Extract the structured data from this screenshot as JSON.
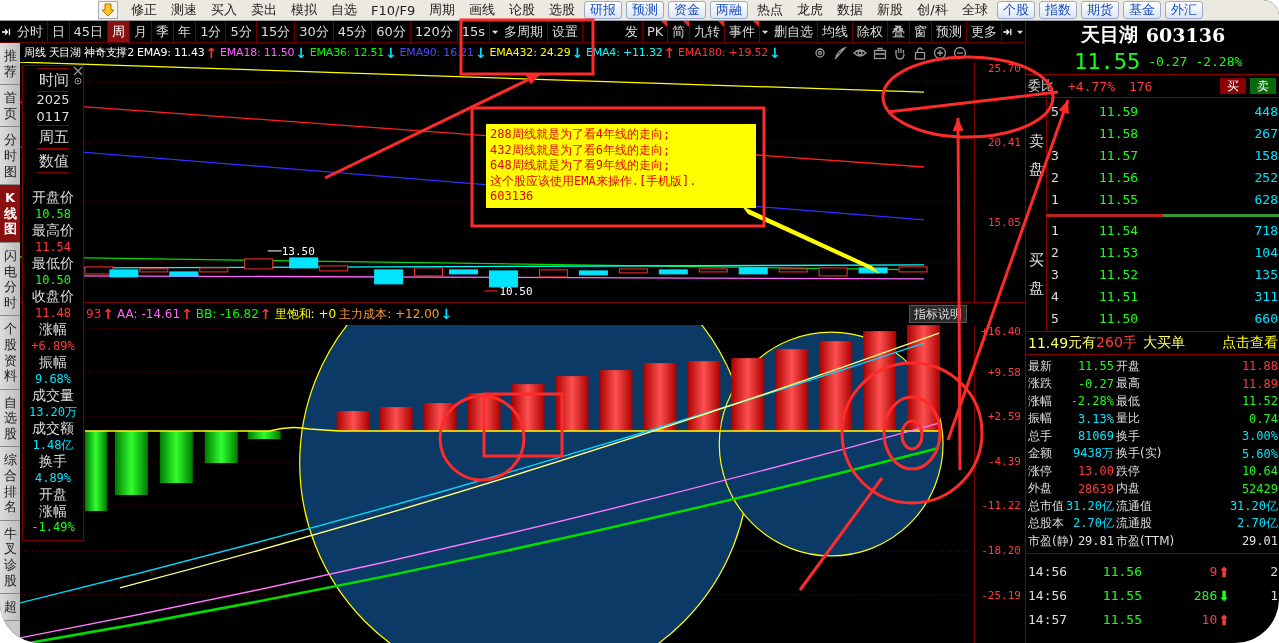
{
  "menu_bar": {
    "items": [
      {
        "label": "修正",
        "kind": "text"
      },
      {
        "label": "测速",
        "kind": "text"
      },
      {
        "label": "买入",
        "kind": "text"
      },
      {
        "label": "卖出",
        "kind": "text"
      },
      {
        "label": "模拟",
        "kind": "text"
      },
      {
        "label": "自选",
        "kind": "text"
      },
      {
        "label": "F10/F9",
        "kind": "text"
      },
      {
        "label": "周期",
        "kind": "text"
      },
      {
        "label": "画线",
        "kind": "text"
      },
      {
        "label": "论股",
        "kind": "text"
      },
      {
        "label": "选股",
        "kind": "text"
      },
      {
        "label": "研报",
        "kind": "button"
      },
      {
        "label": "预测",
        "kind": "button"
      },
      {
        "label": "资金",
        "kind": "button"
      },
      {
        "label": "两融",
        "kind": "button"
      },
      {
        "label": "热点",
        "kind": "text"
      },
      {
        "label": "龙虎",
        "kind": "text"
      },
      {
        "label": "数据",
        "kind": "text"
      },
      {
        "label": "新股",
        "kind": "text"
      },
      {
        "label": "创/科",
        "kind": "text"
      },
      {
        "label": "全球",
        "kind": "text"
      },
      {
        "label": "个股",
        "kind": "button"
      },
      {
        "label": "指数",
        "kind": "button"
      },
      {
        "label": "期货",
        "kind": "button"
      },
      {
        "label": "基金",
        "kind": "button"
      },
      {
        "label": "外汇",
        "kind": "button"
      }
    ]
  },
  "period_toolbar": {
    "tabs": [
      {
        "label": "分时",
        "selected": false
      },
      {
        "label": "日",
        "selected": false
      },
      {
        "label": "45日",
        "selected": false
      },
      {
        "label": "周",
        "selected": true
      },
      {
        "label": "月",
        "selected": false
      },
      {
        "label": "季",
        "selected": false
      },
      {
        "label": "年",
        "selected": false
      },
      {
        "label": "1分",
        "selected": false
      },
      {
        "label": "5分",
        "selected": false
      },
      {
        "label": "15分",
        "selected": false
      },
      {
        "label": "30分",
        "selected": false
      },
      {
        "label": "45分",
        "selected": false
      },
      {
        "label": "60分",
        "selected": false
      },
      {
        "label": "120分",
        "selected": false
      },
      {
        "label": "15s",
        "selected": false
      }
    ],
    "options": [
      "多周期",
      "设置"
    ],
    "tools": [
      {
        "label": "发",
        "flagged": false
      },
      {
        "label": "PK",
        "flagged": true
      },
      {
        "label": "简",
        "flagged": true
      },
      {
        "label": "九转",
        "flagged": true
      },
      {
        "label": "事件",
        "flagged": true
      }
    ],
    "more_tools": [
      "删自选",
      "均线",
      "除权",
      "叠",
      "窗",
      "预测",
      "更多"
    ]
  },
  "side_nav": [
    {
      "label": "推荐",
      "selected": false
    },
    {
      "label": "首页",
      "selected": false
    },
    {
      "label": "分时图",
      "selected": false
    },
    {
      "label": "K线图",
      "selected": true
    },
    {
      "label": "闪电分时",
      "selected": false
    },
    {
      "label": "个股资料",
      "selected": false
    },
    {
      "label": "自选股",
      "selected": false
    },
    {
      "label": "综合排名",
      "selected": false
    },
    {
      "label": "牛叉诊股",
      "selected": false
    },
    {
      "label": "超",
      "selected": false
    }
  ],
  "indicator_header": {
    "items": [
      {
        "text": "周线"
      },
      {
        "text": "天目湖"
      },
      {
        "text": "神奇支撑2"
      },
      {
        "text": "EMA9: 11.43",
        "arrow": {
          "text": "↑",
          "color": "#ff3030"
        }
      },
      {
        "text": "EMA18: 11.50",
        "color": "#ff66ff",
        "arrow": {
          "text": "↓",
          "color": "#00e5ff"
        }
      },
      {
        "text": "EMA36: 12.51",
        "color": "#00ff00",
        "arrow": {
          "text": "↓",
          "color": "#00e5ff"
        }
      },
      {
        "text": "EMA90: 16.21",
        "color": "#4a4aff",
        "arrow": {
          "text": "↓",
          "color": "#00e5ff"
        }
      },
      {
        "text": "EMA432: 24.29",
        "color": "#ffff00",
        "arrow": {
          "text": "↓",
          "color": "#00e5ff"
        }
      },
      {
        "text": "EMA4: +11.32",
        "color": "#00ffff",
        "arrow": {
          "text": "↑",
          "color": "#ff3030"
        }
      },
      {
        "text": "EMA180: +19.52",
        "color": "#ff3030",
        "arrow": {
          "text": "↓",
          "color": "#00e5ff"
        }
      }
    ]
  },
  "info_panel": {
    "header": [
      "时间",
      "2025",
      "0117",
      "周五",
      "数值"
    ],
    "fields": [
      {
        "label": "开盘价",
        "value": "10.58",
        "color": "#1aff1a"
      },
      {
        "label": "最高价",
        "value": "11.54",
        "color": "#ff3a3a"
      },
      {
        "label": "最低价",
        "value": "10.50",
        "color": "#1aff1a"
      },
      {
        "label": "收盘价",
        "value": "11.48",
        "color": "#ff3a3a"
      },
      {
        "label": "涨幅",
        "value": "+6.89%",
        "color": "#ff3a3a"
      },
      {
        "label": "振幅",
        "value": "9.68%",
        "color": "#00e5ff"
      },
      {
        "label": "成交量",
        "value": "13.20万",
        "color": "#00e5ff"
      },
      {
        "label": "成交额",
        "value": "1.48亿",
        "color": "#00e5ff"
      },
      {
        "label": "换手",
        "value": "4.89%",
        "color": "#00e5ff"
      },
      {
        "label": "开盘"
      },
      {
        "label": "涨幅",
        "value": "-1.49%",
        "color": "#1aff1a"
      }
    ]
  },
  "price_chart": {
    "axis": [
      "25.70",
      "20.41",
      "15.05"
    ],
    "high_label": "13.50",
    "low_label": "10.50"
  },
  "lower_header": {
    "items": [
      {
        "text": "93",
        "color": "#ff3030",
        "arrow": {
          "text": "↑",
          "color": "#ff3030"
        }
      },
      {
        "text": "AA: -14.61",
        "color": "#ff66ff",
        "arrow": {
          "text": "↑",
          "color": "#ff3030"
        }
      },
      {
        "text": "BB: -16.82",
        "color": "#00ff00",
        "arrow": {
          "text": "↑",
          "color": "#ff3030"
        }
      },
      {
        "text": "里饱和: +0",
        "color": "#ffff00"
      },
      {
        "text": "主力成本: +12.00",
        "color": "#ff9933",
        "arrow": {
          "text": "↓",
          "color": "#00e5ff"
        }
      }
    ],
    "button": "指标说明"
  },
  "indicator_chart": {
    "axis": [
      "+16.40",
      "+9.58",
      "+2.59",
      "-4.39",
      "-11.22",
      "-18.20",
      "-25.19"
    ]
  },
  "note": {
    "lines": [
      "288周线就是为了看4年线的走向;",
      "432周线就是为了看6年线的走向;",
      "648周线就是为了看9年线的走向;",
      "这个股应该使用EMA来操作.[手机版].",
      "603136"
    ]
  },
  "quote": {
    "name": "天目湖",
    "code": "603136",
    "price": "11.55",
    "change": "-0.27",
    "change_pct": "-2.28%",
    "order_ratio": {
      "label": "委比",
      "value": "+4.77%",
      "diff": "176",
      "buy": "买",
      "sell": "卖"
    },
    "sell_label": "卖盘",
    "sells": [
      {
        "level": "5",
        "price": "11.59",
        "volume": "448"
      },
      {
        "price": "11.58",
        "volume": "267"
      },
      {
        "level": "3",
        "price": "11.57",
        "volume": "158"
      },
      {
        "level": "2",
        "price": "11.56",
        "volume": "252"
      },
      {
        "level": "1",
        "price": "11.55",
        "volume": "628"
      }
    ],
    "buy_label": "买盘",
    "buys": [
      {
        "level": "1",
        "price": "11.54",
        "volume": "718"
      },
      {
        "level": "2",
        "price": "11.53",
        "volume": "104"
      },
      {
        "level": "3",
        "price": "11.52",
        "volume": "135"
      },
      {
        "level": "4",
        "price": "11.51",
        "volume": "311"
      },
      {
        "level": "5",
        "price": "11.50",
        "volume": "660"
      }
    ],
    "big_order": {
      "price": "11.49",
      "unit": "元有",
      "volume": "260手",
      "label": "大买单",
      "link": "点击查看"
    },
    "stats": [
      {
        "label": "最新",
        "value": "11.55",
        "color": "#1aff1a"
      },
      {
        "label": "开盘",
        "value": "11.88",
        "color": "#ff3a3a"
      },
      {
        "label": "涨跌",
        "value": "-0.27",
        "color": "#1aff1a"
      },
      {
        "label": "最高",
        "value": "11.89",
        "color": "#ff3a3a"
      },
      {
        "label": "涨幅",
        "value": "-2.28%",
        "color": "#1aff1a"
      },
      {
        "label": "最低",
        "value": "11.52",
        "color": "#1aff1a"
      },
      {
        "label": "振幅",
        "value": "3.13%",
        "color": "#00e5ff"
      },
      {
        "label": "量比",
        "value": "0.74",
        "color": "#1aff1a"
      },
      {
        "label": "总手",
        "value": "81069",
        "color": "#00e5ff"
      },
      {
        "label": "换手",
        "value": "3.00%",
        "color": "#00e5ff"
      },
      {
        "label": "金额",
        "value": "9438万",
        "color": "#00e5ff"
      },
      {
        "label": "换手(实)",
        "value": "5.60%",
        "color": "#00e5ff"
      },
      {
        "label": "涨停",
        "value": "13.00",
        "color": "#ff3a3a"
      },
      {
        "label": "跌停",
        "value": "10.64",
        "color": "#1aff1a"
      },
      {
        "label": "外盘",
        "value": "28639",
        "color": "#ff3a3a"
      },
      {
        "label": "内盘",
        "value": "52429",
        "color": "#1aff1a"
      },
      {
        "label": "总市值",
        "value": "31.20亿",
        "color": "#00e5ff"
      },
      {
        "label": "流通值",
        "value": "31.20亿",
        "color": "#00e5ff"
      },
      {
        "label": "总股本",
        "value": "2.70亿",
        "color": "#00e5ff"
      },
      {
        "label": "流通股",
        "value": "2.70亿",
        "color": "#00e5ff"
      },
      {
        "label": "市盈(静)",
        "value": "29.81",
        "color": "#e0e0e0"
      },
      {
        "label": "市盈(TTM)",
        "value": "29.01",
        "color": "#e0e0e0"
      }
    ],
    "ticks": [
      {
        "time": "14:56",
        "price": "11.56",
        "volume": {
          "text": "9",
          "color": "#ff3a3a"
        },
        "arrow": {
          "text": "⬆",
          "color": "#ff3a3a"
        },
        "column_4": "2"
      },
      {
        "time": "14:56",
        "price": "11.55",
        "volume": {
          "text": "286",
          "color": "#1aff1a"
        },
        "arrow": {
          "text": "⬇",
          "color": "#1aff1a"
        },
        "column_4": "1"
      },
      {
        "time": "14:57",
        "price": "11.55",
        "volume": {
          "text": "10",
          "color": "#ff3a3a"
        },
        "arrow": {
          "text": "⬆",
          "color": "#ff3a3a"
        }
      }
    ]
  }
}
